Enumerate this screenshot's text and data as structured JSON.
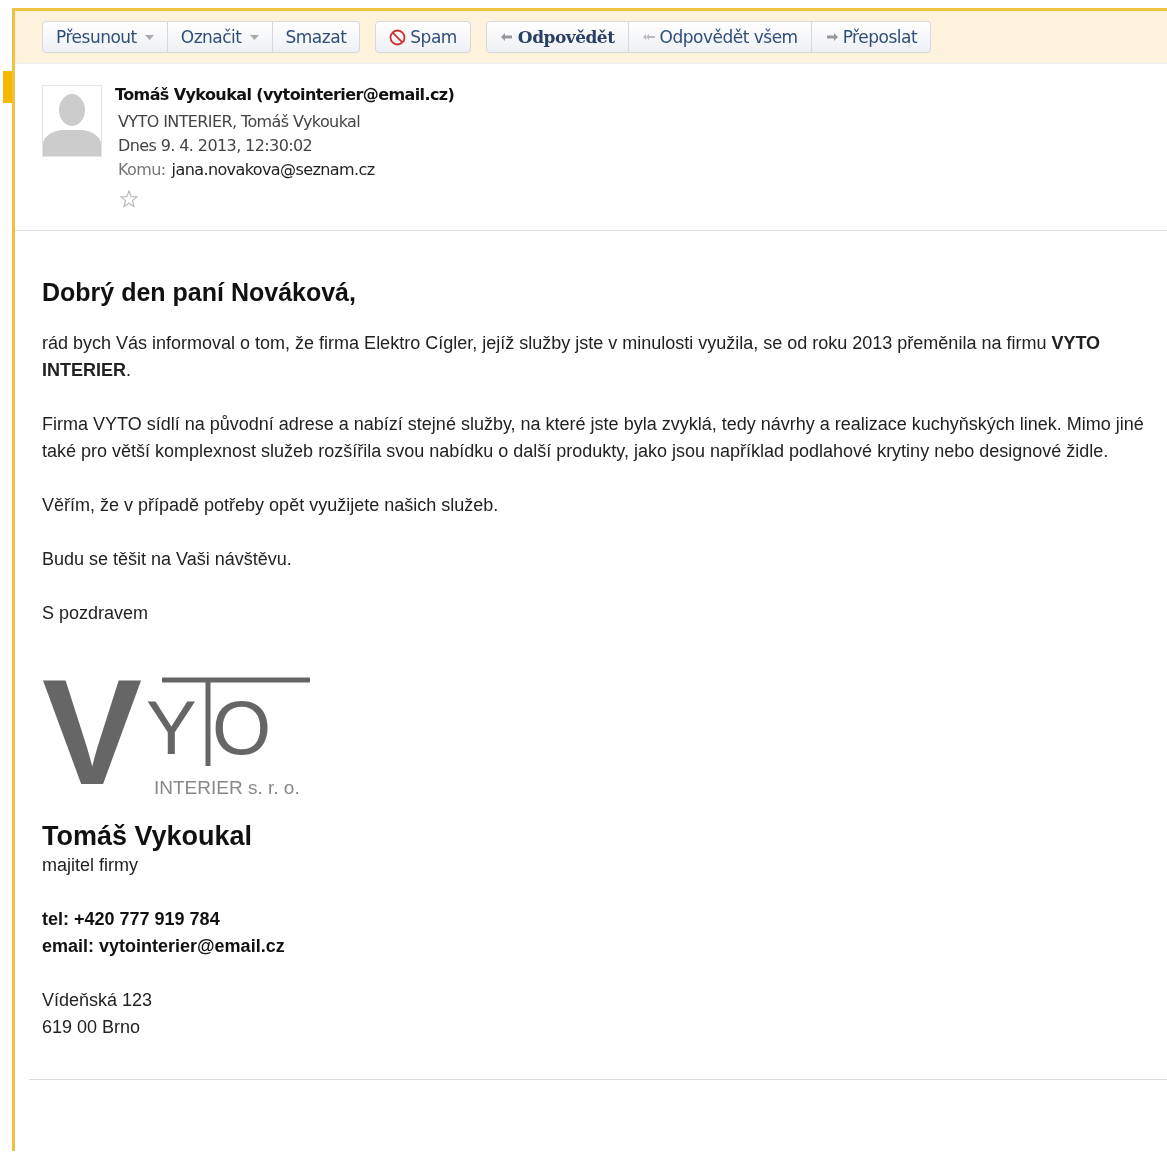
{
  "toolbar": {
    "groups": [
      [
        {
          "label": "Přesunout",
          "kind": "dropdown"
        },
        {
          "label": "Označit",
          "kind": "dropdown"
        },
        {
          "label": "Smazat",
          "kind": "plain"
        }
      ],
      [
        {
          "label": "Spam",
          "kind": "spam"
        }
      ],
      [
        {
          "label": "Odpovědět",
          "kind": "reply"
        },
        {
          "label": "Odpovědět všem",
          "kind": "reply_all"
        },
        {
          "label": "Přeposlat",
          "kind": "forward"
        }
      ]
    ]
  },
  "header": {
    "sender": "Tomáš Vykoukal (vytointerier@email.cz)",
    "organization": "VYTO INTERIER, Tomáš Vykoukal",
    "date": "Dnes 9. 4. 2013, 12:30:02",
    "to_label": "Komu:",
    "to": "jana.novakova@seznam.cz",
    "starred": false
  },
  "body": {
    "greeting": "Dobrý den paní Nováková,",
    "paragraphs": [
      "rád bych Vás informoval o tom, že firma Elektro Cígler, jejíž služby jste v minulosti využila, se od roku 2013 přeměnila na firmu **VYTO INTERIER**.",
      "Firma VYTO sídlí na původní adrese a nabízí stejné služby, na které jste byla zvyklá, tedy návrhy a realizace kuchyňských linek. Mimo jiné také pro větší komplexnost služeb rozšířila svou nabídku o další produkty, jako jsou například podlahové krytiny nebo designové židle.",
      "Věřím, že v případě potřeby opět využijete našich služeb.",
      "Budu se těšit na Vaši návštěvu.",
      "S pozdravem"
    ],
    "logo": {
      "letters": [
        "V",
        "Y",
        "O"
      ],
      "tagline": "INTERIER s. r. o."
    },
    "signature": {
      "name": "Tomáš Vykoukal",
      "role": "majitel firmy",
      "contacts": [
        "tel: +420 777 919 784",
        "email: vytointerier@email.cz"
      ],
      "address": [
        "Vídeňská 123",
        "619 00 Brno"
      ]
    }
  }
}
